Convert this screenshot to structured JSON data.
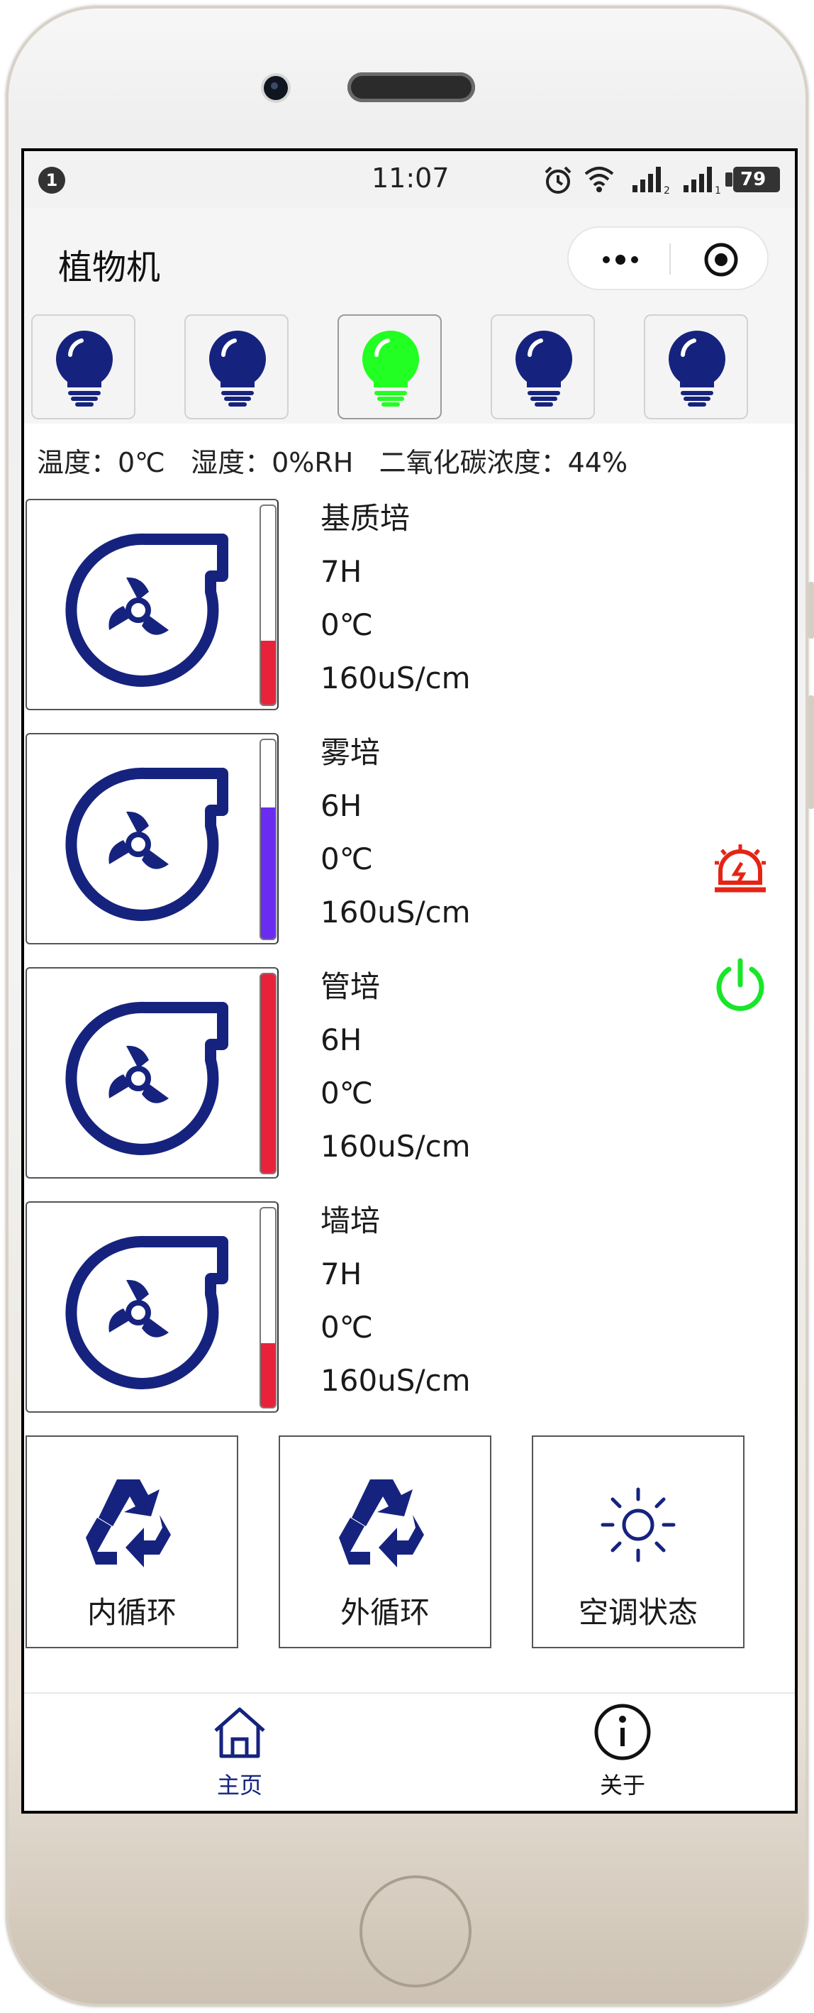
{
  "statusbar": {
    "notification_count": "1",
    "time": "11:07",
    "battery": "79",
    "icons": [
      "alarm-icon",
      "wifi-icon",
      "signal-icon",
      "signal-icon"
    ]
  },
  "header": {
    "title": "植物机",
    "capsule_icons": [
      "more-icon",
      "close-target-icon"
    ]
  },
  "lights": [
    {
      "name": "light-1",
      "on": false
    },
    {
      "name": "light-2",
      "on": false
    },
    {
      "name": "light-3",
      "on": true
    },
    {
      "name": "light-4",
      "on": false
    },
    {
      "name": "light-5",
      "on": false
    }
  ],
  "env": {
    "text": "温度：0℃   湿度：0%RH   二氧化碳浓度：44%"
  },
  "tanks": [
    {
      "name": "基质培",
      "hours": "7H",
      "temp": "0℃",
      "ec": "160uS/cm",
      "level": 0.32,
      "color": "#e8223a"
    },
    {
      "name": "雾培",
      "hours": "6H",
      "temp": "0℃",
      "ec": "160uS/cm",
      "level": 0.66,
      "color": "#6a2cf0"
    },
    {
      "name": "管培",
      "hours": "6H",
      "temp": "0℃",
      "ec": "160uS/cm",
      "level": 1.0,
      "color": "#e8223a"
    },
    {
      "name": "墙培",
      "hours": "7H",
      "temp": "0℃",
      "ec": "160uS/cm",
      "level": 0.32,
      "color": "#e8223a"
    }
  ],
  "side_icons": [
    "alarm-siren-icon",
    "power-icon"
  ],
  "controls": [
    {
      "label": "内循环",
      "icon": "recycle-icon"
    },
    {
      "label": "外循环",
      "icon": "recycle-icon"
    },
    {
      "label": "空调状态",
      "icon": "sun-icon"
    }
  ],
  "tabs": [
    {
      "label": "主页",
      "icon": "home-icon",
      "active": true
    },
    {
      "label": "关于",
      "icon": "info-icon",
      "active": false
    }
  ],
  "colors": {
    "accent": "#16237e",
    "light_on": "#22ff22",
    "alarm": "#e52414",
    "power": "#18e628",
    "text": "#1a1a1a"
  }
}
